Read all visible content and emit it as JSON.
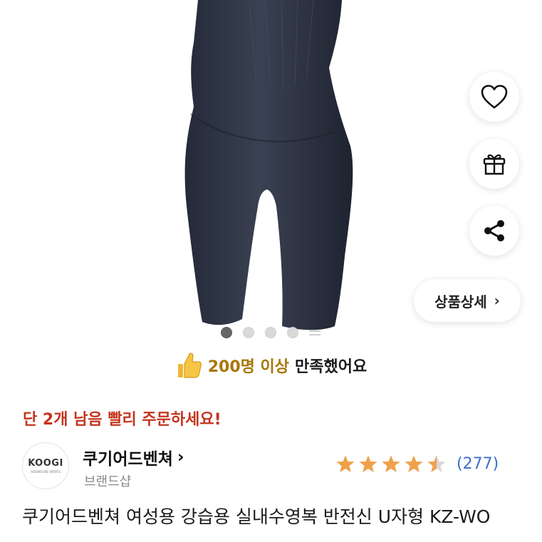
{
  "gallery": {
    "image_label": "product-photo-swimsuit",
    "slide_count": 5,
    "active_slide": 1
  },
  "actions": {
    "wishlist_icon": "heart-icon",
    "gift_icon": "gift-icon",
    "share_icon": "share-icon",
    "detail_label": "상품상세",
    "detail_chevron": "›"
  },
  "satisfaction": {
    "icon": "thumbs-up-icon",
    "highlight": "200명 이상",
    "rest": "만족했어요"
  },
  "stock_alert": "단 2개 남음 빨리 주문하세요!",
  "brand": {
    "logo_text": "KOOGI",
    "logo_subtext": "ADVENTURE SPORTS",
    "name": "쿠기어드벤쳐",
    "chevron": "›",
    "type": "브랜드샵"
  },
  "rating": {
    "value": 4.5,
    "max": 5,
    "review_count": "(277)",
    "star_color": "#f0a04b",
    "empty_color": "#d8d8d8"
  },
  "product": {
    "title": "쿠기어드벤쳐 여성용 강습용 실내수영복 반전신 U자형 KZ-WO"
  },
  "colors": {
    "accent_red": "#c4341e",
    "accent_gold": "#a8770a",
    "link_blue": "#3b6fd0"
  }
}
